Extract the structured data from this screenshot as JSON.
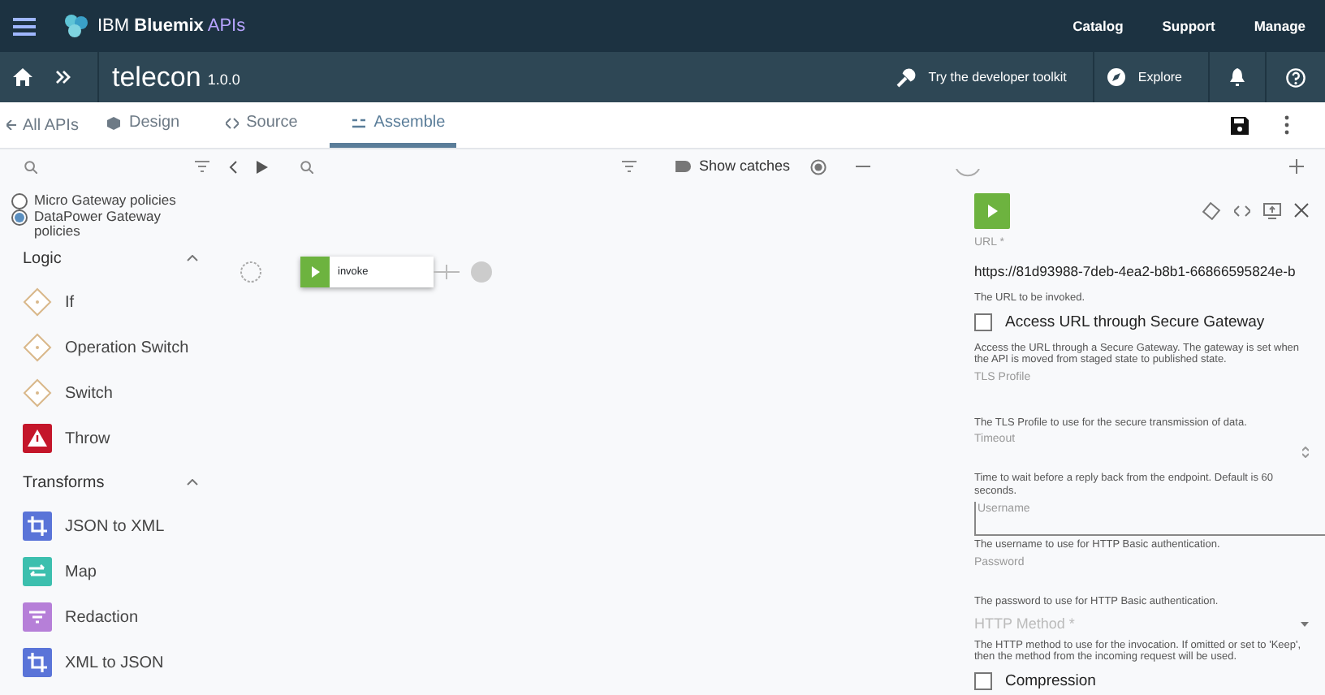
{
  "top_nav": {
    "brand_prefix": "IBM",
    "brand_name": "Bluemix",
    "brand_suffix": "APIs",
    "links": [
      "Catalog",
      "Support",
      "Manage"
    ]
  },
  "api_bar": {
    "title": "telecon",
    "version": "1.0.0",
    "toolkit": "Try the developer toolkit",
    "explore": "Explore"
  },
  "tabs": {
    "back": "All APIs",
    "items": [
      {
        "label": "Design",
        "kind": "design",
        "selected": false
      },
      {
        "label": "Source",
        "kind": "source",
        "selected": false
      },
      {
        "label": "Assemble",
        "kind": "assemble",
        "selected": true
      }
    ]
  },
  "palette": {
    "gateways": [
      {
        "label": "Micro Gateway policies",
        "selected": false
      },
      {
        "label": "DataPower Gateway policies",
        "selected": true
      }
    ],
    "sections": [
      {
        "title": "Logic",
        "expanded": true,
        "items": [
          {
            "label": "If",
            "kind": "logic"
          },
          {
            "label": "Operation Switch",
            "kind": "logic"
          },
          {
            "label": "Switch",
            "kind": "logic"
          },
          {
            "label": "Throw",
            "kind": "throw"
          }
        ]
      },
      {
        "title": "Transforms",
        "expanded": true,
        "items": [
          {
            "label": "JSON to XML",
            "kind": "convert"
          },
          {
            "label": "Map",
            "kind": "map"
          },
          {
            "label": "Redaction",
            "kind": "redact"
          },
          {
            "label": "XML to JSON",
            "kind": "convert"
          }
        ]
      }
    ]
  },
  "canvas": {
    "show_catches": "Show catches",
    "nodes": [
      {
        "label": "invoke"
      }
    ]
  },
  "properties": {
    "fields": [
      {
        "kind": "text",
        "label": "URL *",
        "value": "https://81d93988-7deb-4ea2-b8b1-66866595824e-b",
        "help": "The URL to be invoked."
      },
      {
        "kind": "checkbox",
        "label": "Access URL through Secure Gateway",
        "checked": false,
        "help": "Access the URL through a Secure Gateway. The gateway is set when the API is moved from staged state to published state."
      },
      {
        "kind": "plain",
        "label": "TLS Profile",
        "help": "The TLS Profile to use for the secure transmission of data."
      },
      {
        "kind": "number",
        "label": "Timeout",
        "help": "Time to wait before a reply back from the endpoint. Default is 60 seconds."
      },
      {
        "kind": "boxed",
        "label": "Username",
        "help": "The username to use for HTTP Basic authentication."
      },
      {
        "kind": "plain",
        "label": "Password",
        "help": "The password to use for HTTP Basic authentication."
      },
      {
        "kind": "select",
        "label": "HTTP Method *",
        "help": "The HTTP method to use for the invocation. If omitted or set to 'Keep', then the method from the incoming request will be used."
      },
      {
        "kind": "checkbox",
        "label": "Compression",
        "checked": false
      }
    ]
  }
}
